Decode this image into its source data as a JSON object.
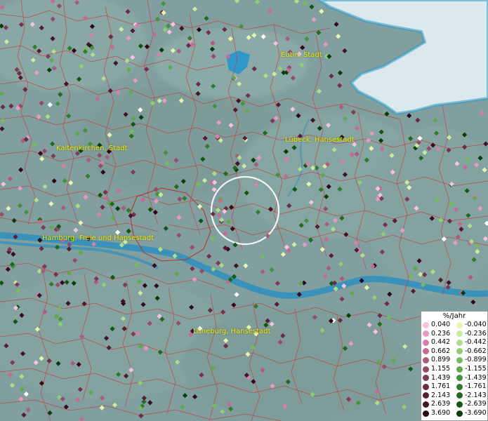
{
  "places": [
    {
      "id": "eutin",
      "name": "Eutin, Stadt"
    },
    {
      "id": "kaltenkirchen",
      "name": "Kaltenkirchen, Stadt"
    },
    {
      "id": "luebeck",
      "name": "Lübeck, Hansestadt"
    },
    {
      "id": "hamburg",
      "name": "Hamburg, Freie und Hansestadt"
    },
    {
      "id": "lueneburg",
      "name": "Lüneburg, Hansestadt"
    }
  ],
  "legend": {
    "title": "%/Jahr",
    "rows": [
      {
        "pos": "0.040",
        "neg": "-0.040",
        "pos_color": "#f6c3df",
        "neg_color": "#e6f5b0"
      },
      {
        "pos": "0.236",
        "neg": "-0.236",
        "pos_color": "#e89ac5",
        "neg_color": "#cbeaa0"
      },
      {
        "pos": "0.442",
        "neg": "-0.442",
        "pos_color": "#d880ad",
        "neg_color": "#b0dd8c"
      },
      {
        "pos": "0.662",
        "neg": "-0.662",
        "pos_color": "#c46a95",
        "neg_color": "#92cc74"
      },
      {
        "pos": "0.899",
        "neg": "-0.899",
        "pos_color": "#ad5a7f",
        "neg_color": "#78bb5f"
      },
      {
        "pos": "1.155",
        "neg": "-1.155",
        "pos_color": "#974b6a",
        "neg_color": "#5fa84c"
      },
      {
        "pos": "1.439",
        "neg": "-1.439",
        "pos_color": "#7f3a55",
        "neg_color": "#44933b"
      },
      {
        "pos": "1.761",
        "neg": "-1.761",
        "pos_color": "#6a2b44",
        "neg_color": "#2f7d2c"
      },
      {
        "pos": "2.143",
        "neg": "-2.143",
        "pos_color": "#561d34",
        "neg_color": "#206a20"
      },
      {
        "pos": "2.639",
        "neg": "-2.639",
        "pos_color": "#431226",
        "neg_color": "#125614"
      },
      {
        "pos": "3.690",
        "neg": "-3.690",
        "pos_color": "#2e0816",
        "neg_color": "#073f0a"
      }
    ]
  }
}
